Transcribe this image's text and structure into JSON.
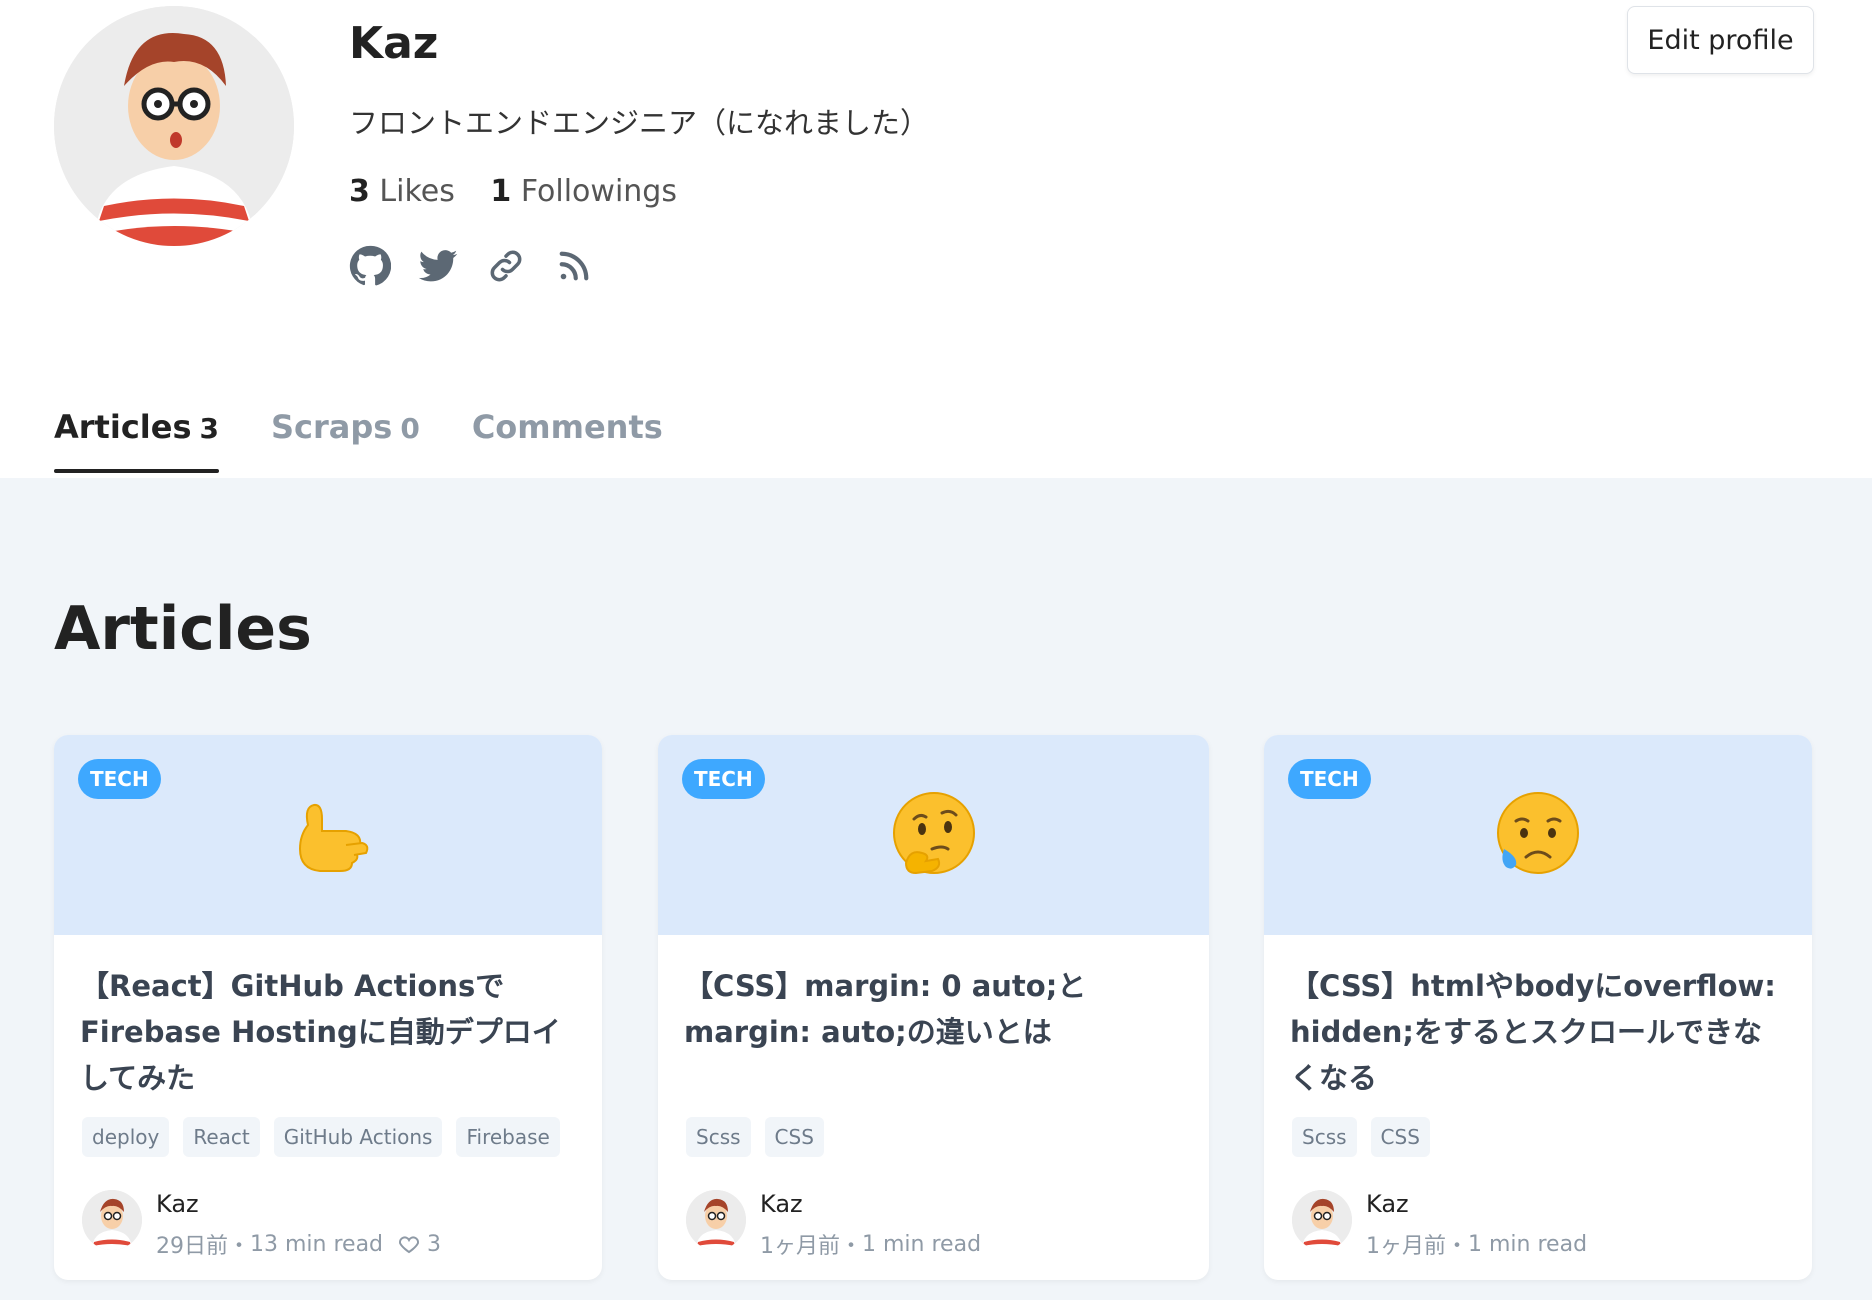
{
  "profile": {
    "name": "Kaz",
    "bio": "フロントエンドエンジニア（になれました）",
    "likes_count": "3",
    "likes_label": "Likes",
    "followings_count": "1",
    "followings_label": "Followings",
    "edit_label": "Edit profile",
    "social_icons": [
      "github-icon",
      "twitter-icon",
      "link-icon",
      "rss-icon"
    ]
  },
  "tabs": [
    {
      "label": "Articles",
      "count": "3",
      "active": true
    },
    {
      "label": "Scraps",
      "count": "0",
      "active": false
    },
    {
      "label": "Comments",
      "count": "",
      "active": false
    }
  ],
  "section_title": "Articles",
  "colors": {
    "accent": "#3ea8ff",
    "card_top": "#dbe9fb",
    "main_bg": "#f1f5f9"
  },
  "articles": [
    {
      "badge": "TECH",
      "emoji": "call-me-hand",
      "title": "【React】GitHub ActionsでFirebase Hostingに自動デプロイしてみた",
      "tags": [
        "deploy",
        "React",
        "GitHub Actions",
        "Firebase"
      ],
      "author": "Kaz",
      "date": "29日前",
      "read_time": "13 min read",
      "likes": "3"
    },
    {
      "badge": "TECH",
      "emoji": "thinking-face",
      "title": "【CSS】margin: 0 auto;とmargin: auto;の違いとは",
      "tags": [
        "Scss",
        "CSS"
      ],
      "author": "Kaz",
      "date": "1ヶ月前",
      "read_time": "1 min read",
      "likes": ""
    },
    {
      "badge": "TECH",
      "emoji": "sad-sweat-face",
      "title": "【CSS】htmlやbodyにoverflow: hidden;をするとスクロールできなくなる",
      "tags": [
        "Scss",
        "CSS"
      ],
      "author": "Kaz",
      "date": "1ヶ月前",
      "read_time": "1 min read",
      "likes": ""
    }
  ]
}
